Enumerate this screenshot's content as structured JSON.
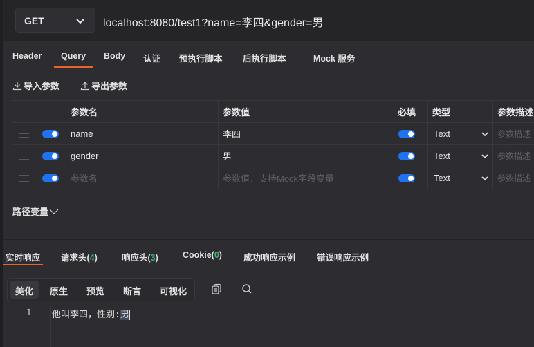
{
  "request": {
    "method": "GET",
    "url": "localhost:8080/test1?name=李四&gender=男"
  },
  "request_tabs": [
    {
      "label": "Header",
      "active": false
    },
    {
      "label": "Query",
      "active": true
    },
    {
      "label": "Body",
      "active": false
    },
    {
      "label": "认证",
      "active": false
    },
    {
      "label": "预执行脚本",
      "active": false
    },
    {
      "label": "后执行脚本",
      "active": false
    },
    {
      "label": "Mock 服务",
      "active": false
    }
  ],
  "actions": {
    "import_label": "导入参数",
    "export_label": "导出参数"
  },
  "params_table": {
    "headers": {
      "name": "参数名",
      "value": "参数值",
      "required": "必填",
      "type": "类型",
      "description": "参数描述"
    },
    "rows": [
      {
        "enabled": true,
        "name": "name",
        "value": "李四",
        "required": true,
        "type": "Text",
        "description_placeholder": "参数描述"
      },
      {
        "enabled": true,
        "name": "gender",
        "value": "男",
        "required": true,
        "type": "Text",
        "description_placeholder": "参数描述"
      },
      {
        "enabled": true,
        "name_placeholder": "参数名",
        "value_placeholder": "参数值，支持Mock字段变量",
        "required": true,
        "type": "Text",
        "description_placeholder": "参数描述"
      }
    ]
  },
  "path_variables": {
    "label": "路径变量"
  },
  "response_tabs": [
    {
      "label": "实时响应",
      "active": true
    },
    {
      "label": "请求头(",
      "count": "4",
      "suffix": ")"
    },
    {
      "label": "响应头(",
      "count": "3",
      "suffix": ")"
    },
    {
      "label": "Cookie(",
      "count": "0",
      "suffix": ")"
    },
    {
      "label": "成功响应示例"
    },
    {
      "label": "错误响应示例"
    }
  ],
  "view_modes": [
    {
      "label": "美化",
      "active": true
    },
    {
      "label": "原生"
    },
    {
      "label": "预览"
    },
    {
      "label": "断言"
    },
    {
      "label": "可视化"
    }
  ],
  "response_body": {
    "line_number": "1",
    "text": "他叫李四，性别:",
    "selected": "男"
  },
  "colors": {
    "accent": "#e8632c",
    "toggle": "#1f73f0",
    "count": "#3cb371"
  }
}
